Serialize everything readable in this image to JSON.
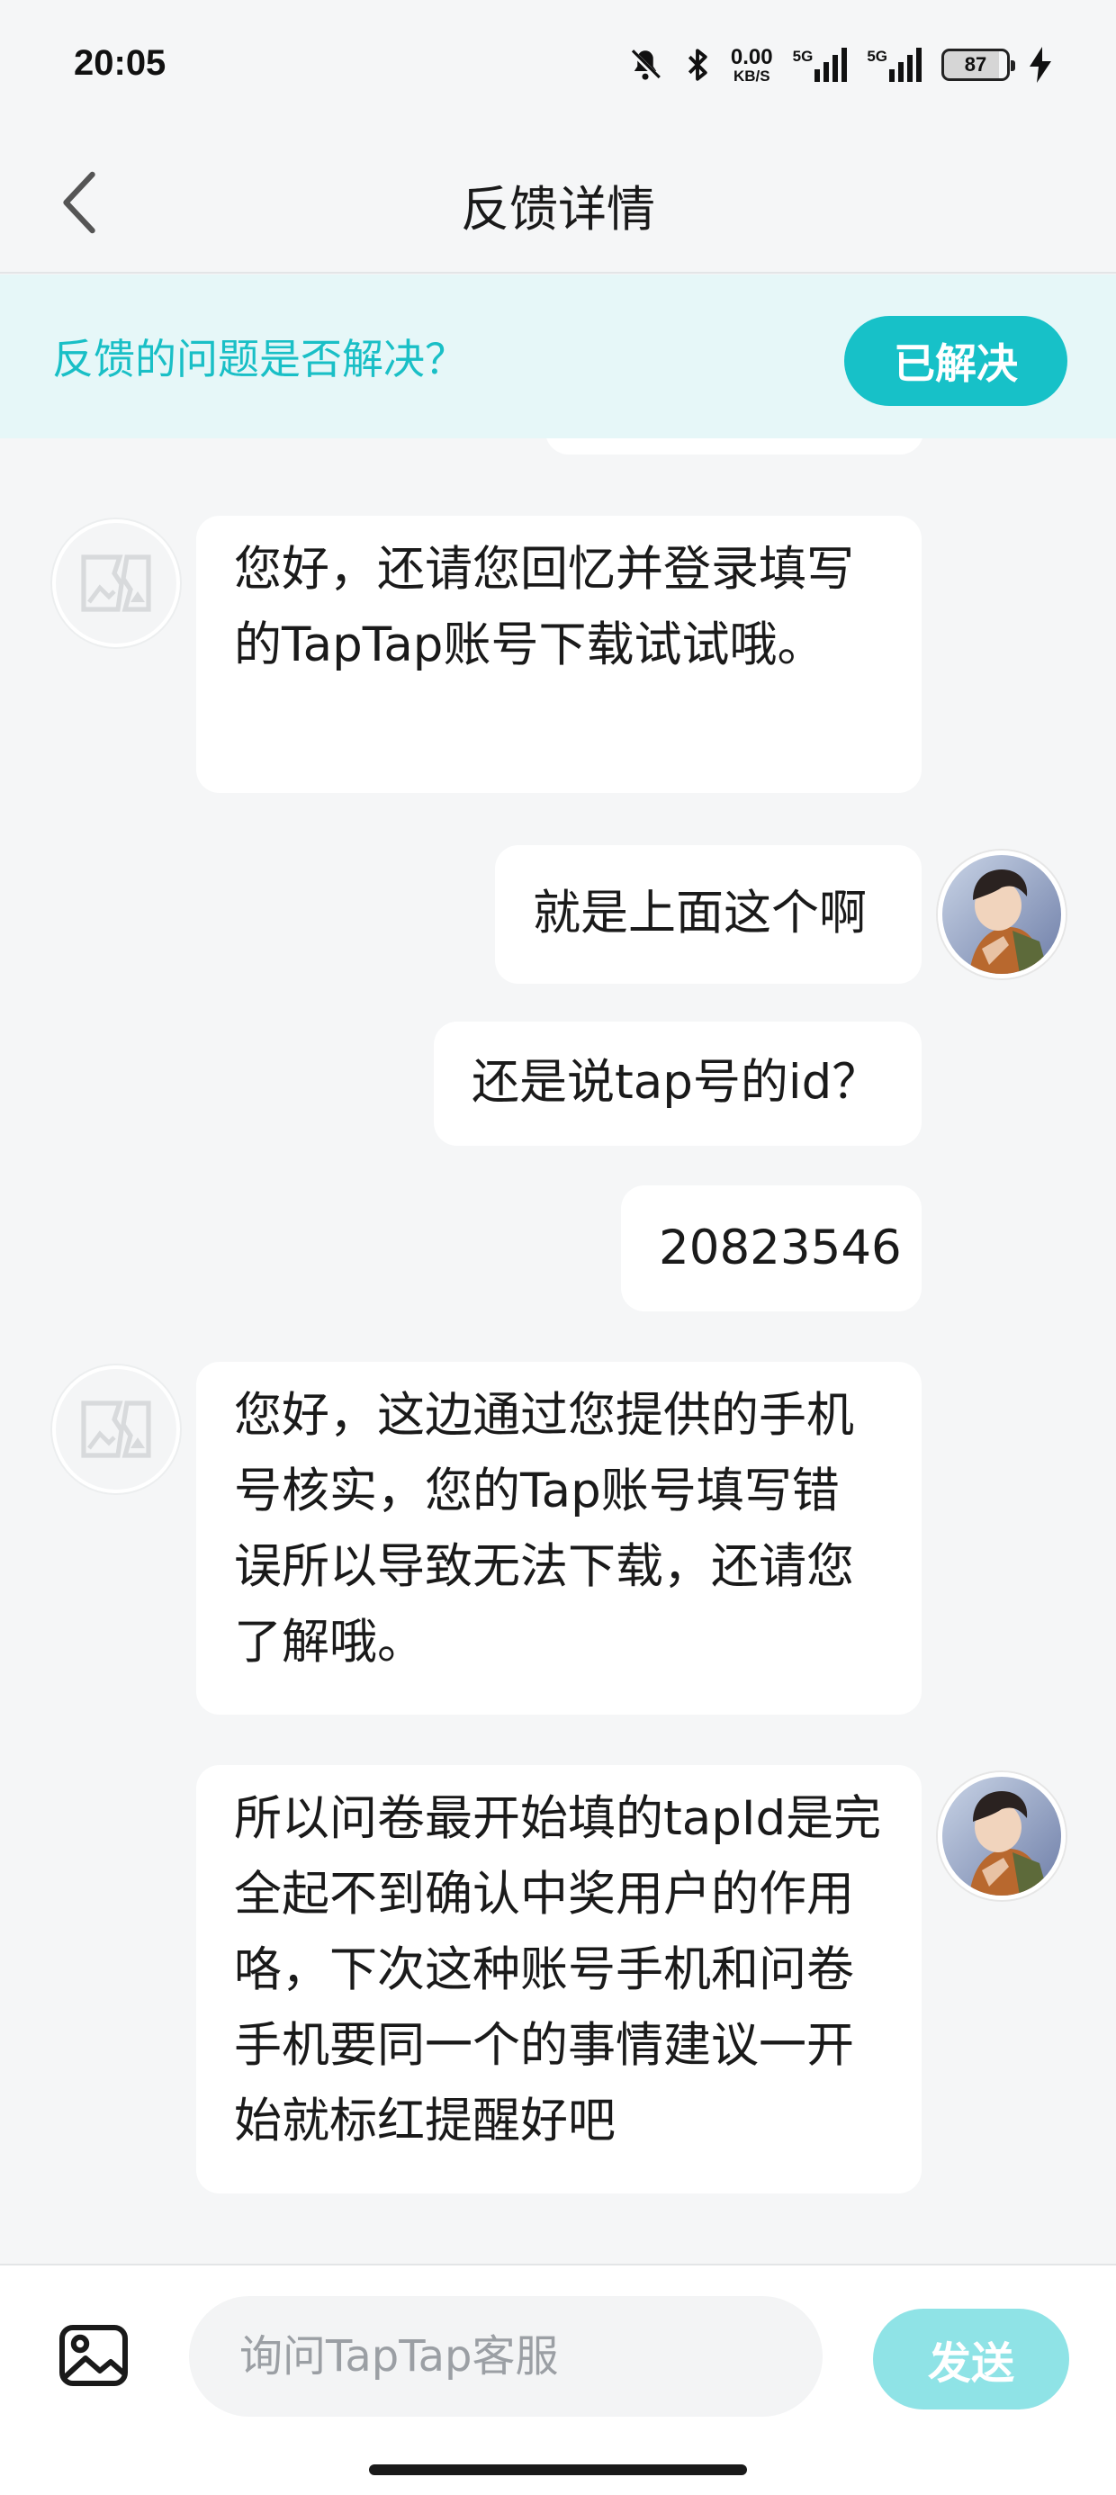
{
  "status_bar": {
    "time": "20:05",
    "net_speed_value": "0.00",
    "net_speed_unit": "KB/S",
    "sim1_label": "5G",
    "sim2_label": "5G",
    "battery_level": "87",
    "icons": [
      "mute-bell-icon",
      "bluetooth-icon",
      "signal-icon",
      "signal-icon",
      "battery-icon",
      "charging-icon"
    ]
  },
  "header": {
    "title": "反馈详情",
    "back_icon": "chevron-left-icon"
  },
  "resolve_bar": {
    "question": "反馈的问题是否解决？",
    "button_label": "已解决"
  },
  "messages": [
    {
      "sender": "agent",
      "text": "您好，还请您回忆并登录填写的TapTap账号下载试试哦。"
    },
    {
      "sender": "user",
      "text": "就是上面这个啊"
    },
    {
      "sender": "user",
      "text": "还是说tap号的id？"
    },
    {
      "sender": "user",
      "text": "20823546"
    },
    {
      "sender": "agent",
      "text": "您好，这边通过您提供的手机号核实，您的Tap账号填写错误所以导致无法下载，还请您了解哦。"
    },
    {
      "sender": "user",
      "text": "所以问卷最开始填的tapId是完全起不到确认中奖用户的作用咯，下次这种账号手机和问卷手机要同一个的事情建议一开始就标红提醒好吧"
    }
  ],
  "input_bar": {
    "image_icon": "image-icon",
    "placeholder": "询问TapTap客服",
    "send_label": "发送"
  },
  "colors": {
    "accent": "#17c1c8",
    "accent_light": "#8fe3e6",
    "resolve_bg": "#e6f7f8",
    "page_bg": "#f5f6f7"
  }
}
